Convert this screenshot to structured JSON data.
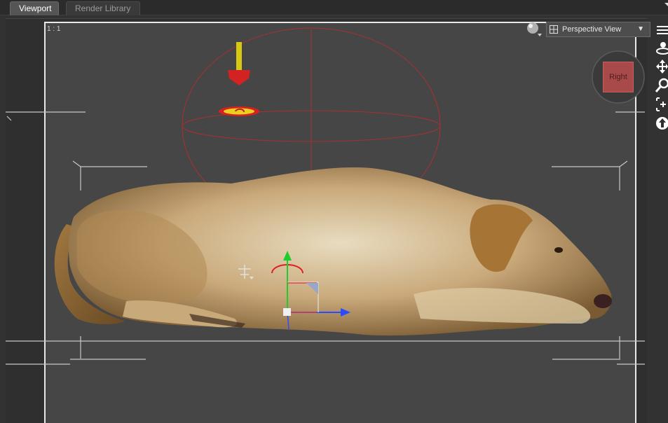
{
  "tabs": [
    {
      "label": "Viewport",
      "active": true
    },
    {
      "label": "Render Library",
      "active": false
    }
  ],
  "viewport": {
    "aspect_label": "1 : 1",
    "view_select": {
      "selected": "Perspective View"
    },
    "viewcube": {
      "face_label": "Right"
    }
  },
  "colors": {
    "frame_border": "#e8e8e8",
    "viewcube_face": "#a84a4a",
    "gizmo_x": "#2a4cff",
    "gizmo_y": "#1fcc2f",
    "gizmo_z": "#e04040",
    "sphere_guide": "#b03030"
  },
  "toolbar_icons": [
    "orbit-icon",
    "pan-icon",
    "zoom-icon",
    "frame-icon",
    "reset-view-icon"
  ]
}
